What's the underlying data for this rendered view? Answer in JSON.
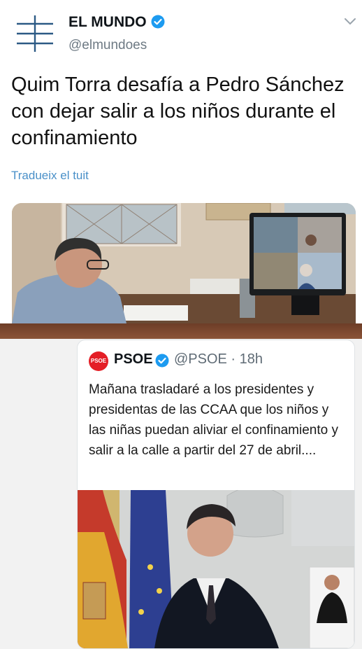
{
  "tweet": {
    "account_name": "EL MUNDO",
    "account_handle": "@elmundoes",
    "text": "Quim Torra desafía a Pedro Sánchez con dejar salir a los niños durante el confinamiento",
    "translate_link": "Tradueix el tuit",
    "icons": [
      "el-mundo-logo",
      "verified-badge-icon",
      "chevron-down-icon"
    ]
  },
  "quoted_tweet": {
    "avatar_text": "PSOE",
    "account_name": "PSOE",
    "meta": "@PSOE · 18h",
    "text": "Mañana trasladaré a los presidentes y presidentas de las CCAA que los niños y las niñas puedan aliviar el confinamiento y salir a la calle a partir del 27 de abril...."
  },
  "colors": {
    "link": "#4a90c8",
    "verified": "#1d9bf0",
    "psoe_red": "#e41e26",
    "divider": "#7a4630"
  }
}
